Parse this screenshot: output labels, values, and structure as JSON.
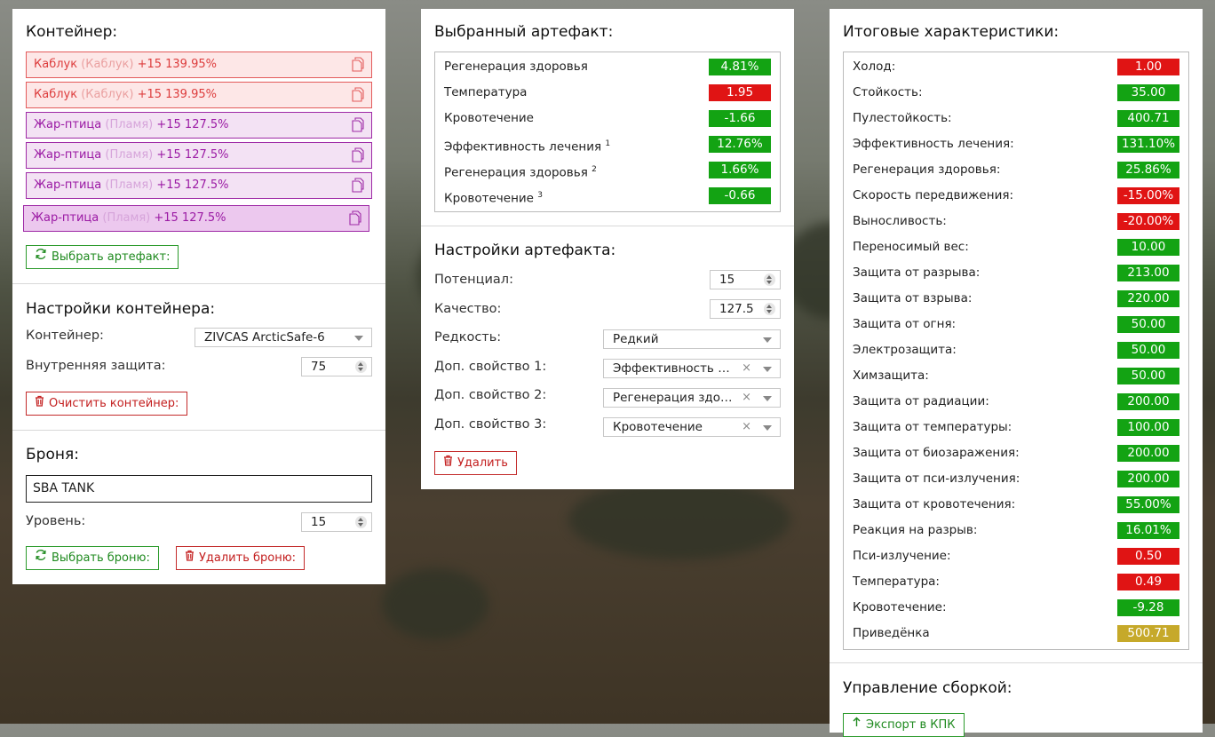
{
  "container_panel": {
    "title": "Контейнер:",
    "artifacts": [
      {
        "name": "Каблук",
        "type": "(Каблук)",
        "bonus": "+15 139.95%",
        "color": "red",
        "selected": false
      },
      {
        "name": "Каблук",
        "type": "(Каблук)",
        "bonus": "+15 139.95%",
        "color": "red",
        "selected": false
      },
      {
        "name": "Жар-птица",
        "type": "(Пламя)",
        "bonus": "+15 127.5%",
        "color": "purple",
        "selected": false
      },
      {
        "name": "Жар-птица",
        "type": "(Пламя)",
        "bonus": "+15 127.5%",
        "color": "purple",
        "selected": false
      },
      {
        "name": "Жар-птица",
        "type": "(Пламя)",
        "bonus": "+15 127.5%",
        "color": "purple",
        "selected": false
      },
      {
        "name": "Жар-птица",
        "type": "(Пламя)",
        "bonus": "+15 127.5%",
        "color": "purple",
        "selected": true
      }
    ],
    "select_artifact_button": "Выбрать артефакт:"
  },
  "container_settings": {
    "title": "Настройки контейнера:",
    "container_label": "Контейнер:",
    "container_value": "ZIVCAS ArcticSafe-6",
    "inner_protection_label": "Внутренняя защита:",
    "inner_protection_value": "75",
    "clear_button": "Очистить контейнер:"
  },
  "armor": {
    "title": "Броня:",
    "name_value": "SBA TANK",
    "level_label": "Уровень:",
    "level_value": "15",
    "select_button": "Выбрать броню:",
    "delete_button": "Удалить броню:"
  },
  "selected_artifact": {
    "title": "Выбранный артефакт:",
    "stats": [
      {
        "label": "Регенерация здоровья",
        "sup": "",
        "value": "4.81%",
        "status": "good"
      },
      {
        "label": "Температура",
        "sup": "",
        "value": "1.95",
        "status": "bad"
      },
      {
        "label": "Кровотечение",
        "sup": "",
        "value": "-1.66",
        "status": "good"
      },
      {
        "label": "Эффективность лечения",
        "sup": "1",
        "value": "12.76%",
        "status": "good"
      },
      {
        "label": "Регенерация здоровья",
        "sup": "2",
        "value": "1.66%",
        "status": "good"
      },
      {
        "label": "Кровотечение",
        "sup": "3",
        "value": "-0.66",
        "status": "good"
      }
    ]
  },
  "artifact_settings": {
    "title": "Настройки артефакта:",
    "potential_label": "Потенциал:",
    "potential_value": "15",
    "quality_label": "Качество:",
    "quality_value": "127.5",
    "rarity_label": "Редкость:",
    "rarity_value": "Редкий",
    "extra1_label": "Доп. свойство 1:",
    "extra1_value": "Эффективность лечения",
    "extra2_label": "Доп. свойство 2:",
    "extra2_value": "Регенерация здоровья",
    "extra3_label": "Доп. свойство 3:",
    "extra3_value": "Кровотечение",
    "clear_symbol": "×",
    "delete_button": "Удалить"
  },
  "totals": {
    "title": "Итоговые характеристики:",
    "stats": [
      {
        "label": "Холод:",
        "value": "1.00",
        "status": "bad"
      },
      {
        "label": "Стойкость:",
        "value": "35.00",
        "status": "good"
      },
      {
        "label": "Пулестойкость:",
        "value": "400.71",
        "status": "good"
      },
      {
        "label": "Эффективность лечения:",
        "value": "131.10%",
        "status": "good"
      },
      {
        "label": "Регенерация здоровья:",
        "value": "25.86%",
        "status": "good"
      },
      {
        "label": "Скорость передвижения:",
        "value": "-15.00%",
        "status": "bad"
      },
      {
        "label": "Выносливость:",
        "value": "-20.00%",
        "status": "bad"
      },
      {
        "label": "Переносимый вес:",
        "value": "10.00",
        "status": "good"
      },
      {
        "label": "Защита от разрыва:",
        "value": "213.00",
        "status": "good"
      },
      {
        "label": "Защита от взрыва:",
        "value": "220.00",
        "status": "good"
      },
      {
        "label": "Защита от огня:",
        "value": "50.00",
        "status": "good"
      },
      {
        "label": "Электрозащита:",
        "value": "50.00",
        "status": "good"
      },
      {
        "label": "Химзащита:",
        "value": "50.00",
        "status": "good"
      },
      {
        "label": "Защита от радиации:",
        "value": "200.00",
        "status": "good"
      },
      {
        "label": "Защита от температуры:",
        "value": "100.00",
        "status": "good"
      },
      {
        "label": "Защита от биозаражения:",
        "value": "200.00",
        "status": "good"
      },
      {
        "label": "Защита от пси-излучения:",
        "value": "200.00",
        "status": "good"
      },
      {
        "label": "Защита от кровотечения:",
        "value": "55.00%",
        "status": "good"
      },
      {
        "label": "Реакция на разрыв:",
        "value": "16.01%",
        "status": "good"
      },
      {
        "label": "Пси-излучение:",
        "value": "0.50",
        "status": "bad"
      },
      {
        "label": "Температура:",
        "value": "0.49",
        "status": "bad"
      },
      {
        "label": "Кровотечение:",
        "value": "-9.28",
        "status": "good"
      },
      {
        "label": "Приведёнка",
        "value": "500.71",
        "status": "summary"
      }
    ]
  },
  "build_management": {
    "title": "Управление сборкой:",
    "export_button": "Экспорт в КПК"
  },
  "colors": {
    "good": "#13a313",
    "bad": "#e01414",
    "summary": "#c6a92a",
    "red_artifact": "#dd3d3d",
    "purple_artifact": "#9b1aa4"
  }
}
